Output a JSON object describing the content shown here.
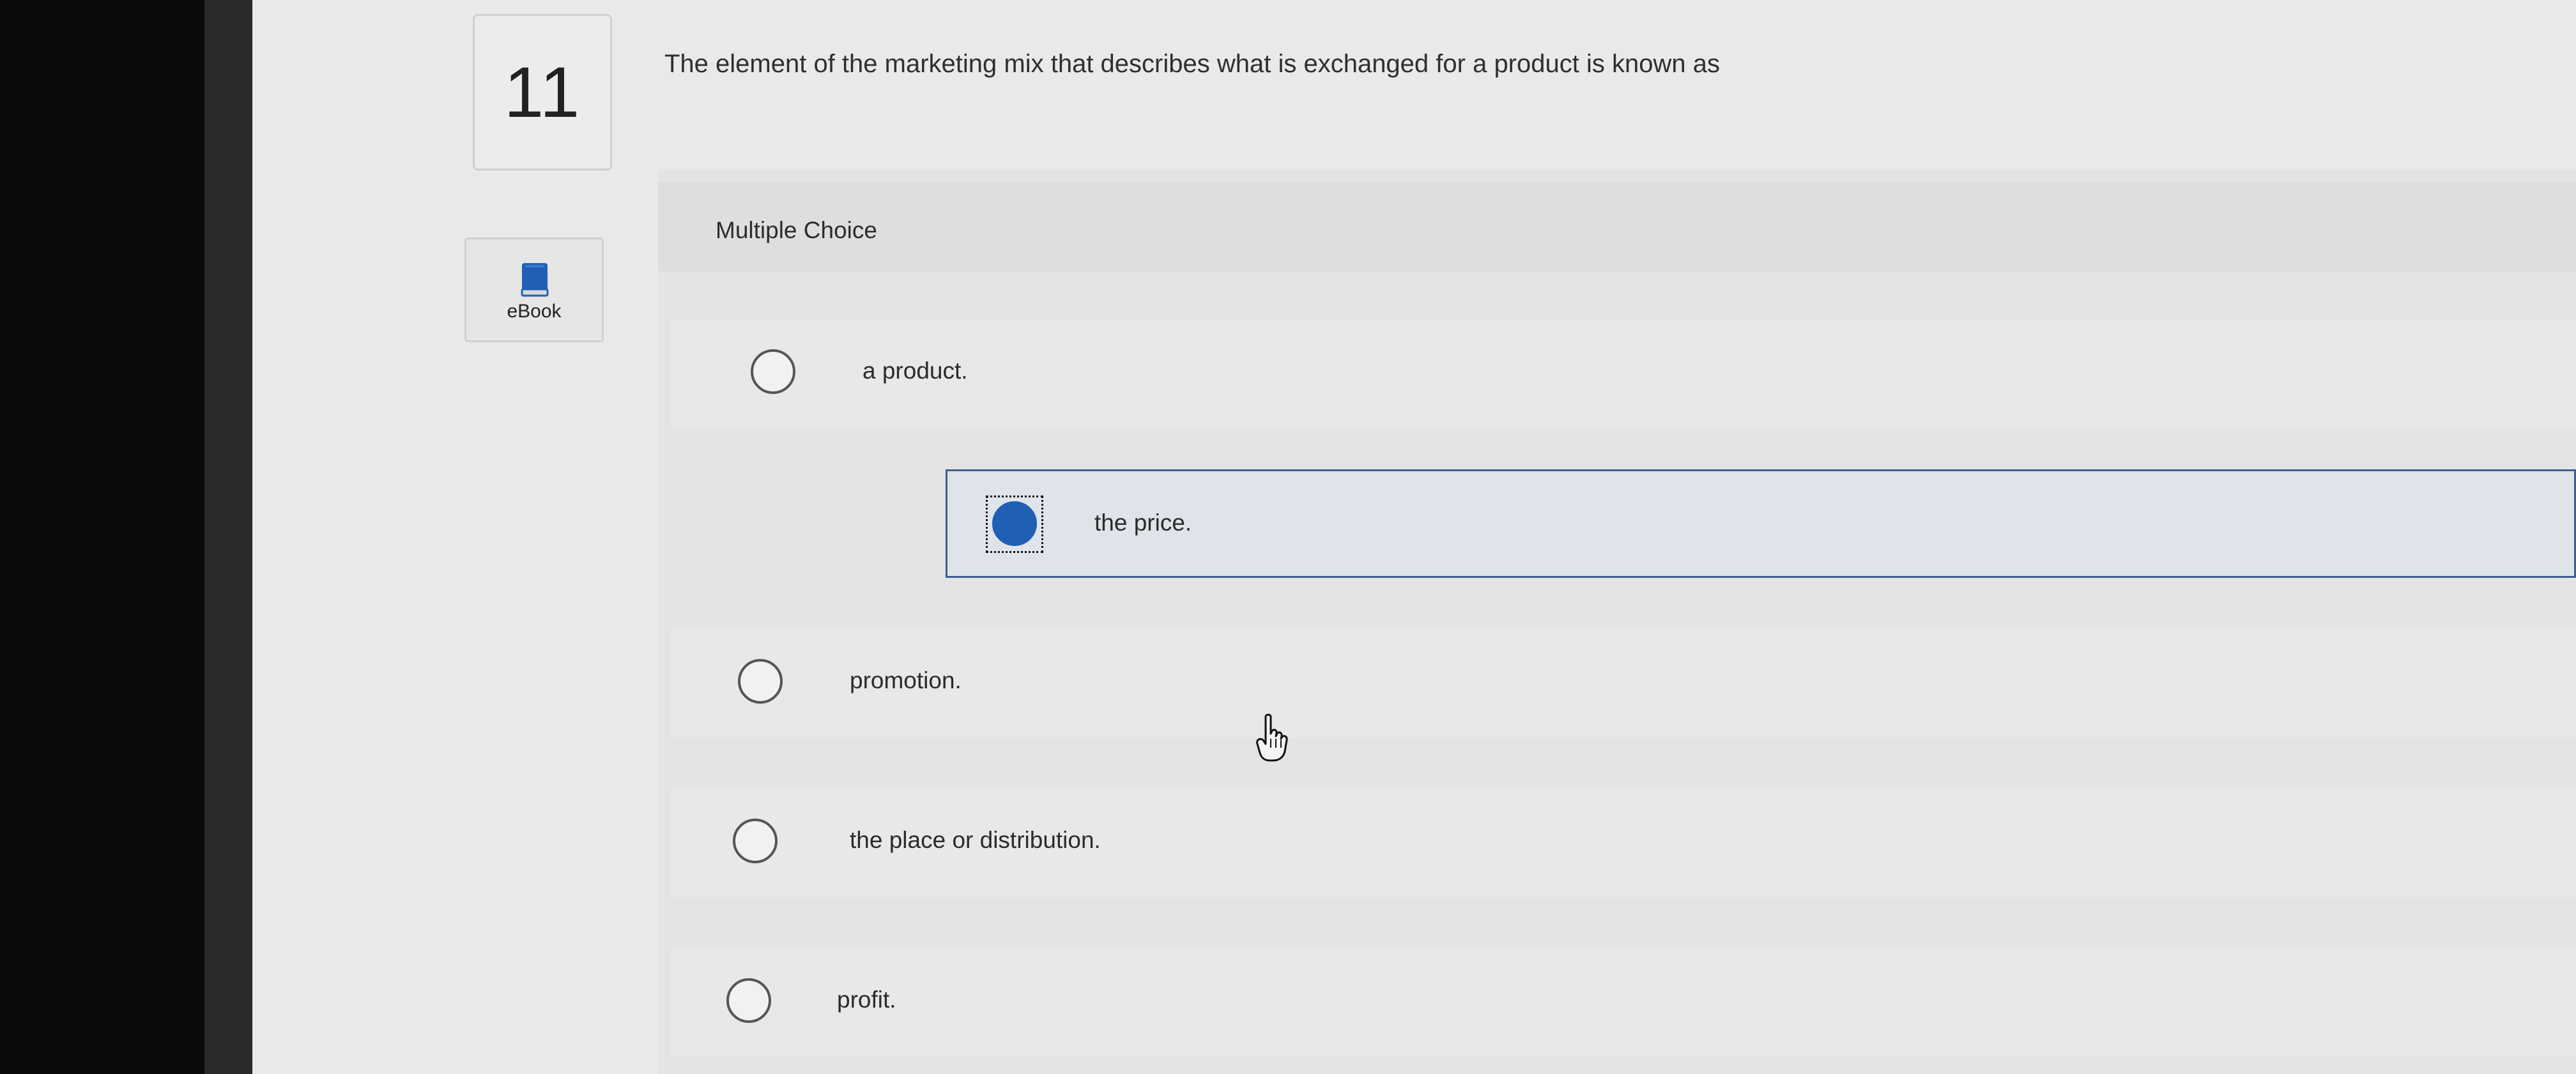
{
  "question": {
    "number": "11",
    "text": "The element of the marketing mix that describes what is exchanged for a product is known as"
  },
  "sidebar": {
    "ebook_label": "eBook",
    "ebook_icon": "book-icon"
  },
  "choices": {
    "header": "Multiple Choice",
    "options": [
      {
        "label": "a product.",
        "selected": false
      },
      {
        "label": "the price.",
        "selected": true
      },
      {
        "label": "promotion.",
        "selected": false
      },
      {
        "label": "the place or distribution.",
        "selected": false
      },
      {
        "label": "profit.",
        "selected": false
      }
    ]
  },
  "colors": {
    "accent": "#1f5fb4",
    "selected_border": "#3d5f8f",
    "page_background": "#e9e9e9"
  }
}
